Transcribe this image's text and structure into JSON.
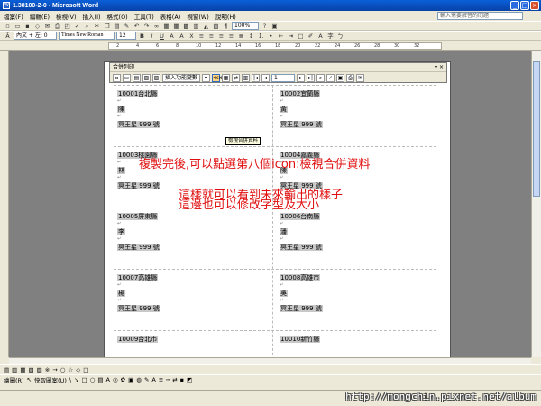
{
  "window": {
    "title": "1.38100-2-0 - Microsoft Word"
  },
  "menubar": {
    "items": [
      "檔案(F)",
      "編輯(E)",
      "檢視(V)",
      "插入(I)",
      "格式(O)",
      "工具(T)",
      "表格(A)",
      "視窗(W)",
      "說明(H)"
    ],
    "help_placeholder": "輸入需要解答的問題"
  },
  "formatting": {
    "style": "內文 + 左: 0",
    "font": "Times New Roman",
    "size": "12",
    "zoom": "100%"
  },
  "mailmerge": {
    "title": "合併列印",
    "insert_field_label": "插入功能變數",
    "record_number": "1",
    "tooltip": "檢視合併資料"
  },
  "labels": [
    {
      "zip_city": "10001台北縣",
      "name": "陳",
      "address": "冥王星 999 號"
    },
    {
      "zip_city": "10002宜蘭縣",
      "name": "黃",
      "address": "冥王星 999 號"
    },
    {
      "zip_city": "10003桃園縣",
      "name": "林",
      "address": "冥王星 999 號"
    },
    {
      "zip_city": "10004嘉義縣",
      "name": "陳",
      "address": "冥王星 999 號"
    },
    {
      "zip_city": "10005屏東縣",
      "name": "李",
      "address": "冥王星 999 號"
    },
    {
      "zip_city": "10006台南縣",
      "name": "潘",
      "address": "冥王星 999 號"
    },
    {
      "zip_city": "10007高雄縣",
      "name": "楊",
      "address": "冥王星 999 號"
    },
    {
      "zip_city": "10008高雄市",
      "name": "吳",
      "address": "冥王星 999 號"
    },
    {
      "zip_city": "10009台北市",
      "name": "",
      "address": ""
    },
    {
      "zip_city": "10010新竹縣",
      "name": "",
      "address": ""
    }
  ],
  "annotations": {
    "line1": "複製完後,可以點選第八個icon:檢視合併資料",
    "line2": "這樣就可以看到未來輸出的樣子",
    "line3": "這邊也可以修改字型及大小"
  },
  "drawing": {
    "draw_label": "繪圖(R)",
    "autoshapes_label": "快取圖案(U)"
  },
  "watermark": "http://mongchin.pixnet.net/album",
  "colors": {
    "annotation": "#e01010",
    "titlebar": "#0a5fd8"
  }
}
